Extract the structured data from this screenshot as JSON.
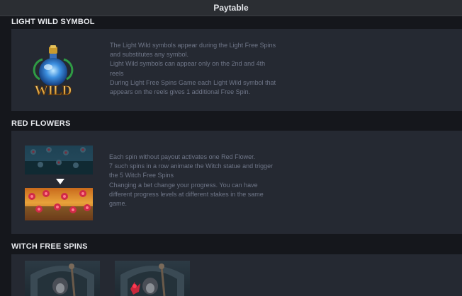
{
  "window": {
    "title": "Paytable"
  },
  "sections": [
    {
      "heading": "LIGHT WILD SYMBOL",
      "icon": "wild-potion-icon",
      "icon_text": "WILD",
      "lines": [
        "The Light Wild symbols appear during the Light Free Spins",
        "and substitutes any symbol.",
        "Light Wild symbols can appear only on the 2nd and 4th",
        "reels",
        "During Light Free Spins Game each Light Wild symbol that",
        "appears on the reels gives 1 additional Free Spin."
      ]
    },
    {
      "heading": "RED FLOWERS",
      "icon": "red-flowers-progress-image",
      "lines": [
        "Each spin without payout activates one Red Flower.",
        "7 such spins in a row animate the Witch statue and trigger",
        "the 5 Witch Free Spins",
        "Changing a bet change your progress. You can have",
        "different progress levels at different stakes in the same",
        "game."
      ]
    },
    {
      "heading": "WITCH FREE SPINS",
      "icon": "witch-statue-image"
    }
  ],
  "colors": {
    "background": "#15171c",
    "panel": "#252932",
    "text_muted": "#6f7688",
    "heading": "#e8eaee",
    "flower_red": "#c8283c",
    "wild_gold": "#e8b233"
  }
}
